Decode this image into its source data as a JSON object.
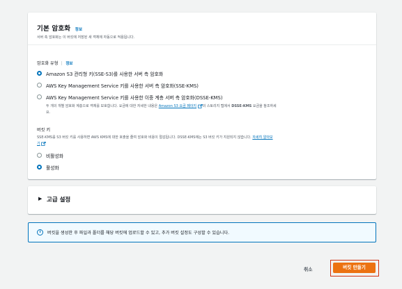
{
  "encryption": {
    "title": "기본 암호화",
    "info_label": "정보",
    "description": "서버 측 암호화는 이 버킷에 저장된 새 객체에 자동으로 적용됩니다.",
    "type_label": "암호화 유형",
    "type_info_label": "정보",
    "options": [
      {
        "label": "Amazon S3 관리형 키(SSE-S3)를 사용한 서버 측 암호화",
        "selected": true
      },
      {
        "label": "AWS Key Management Service 키를 사용한 서버 측 암호화(SSE-KMS)",
        "selected": false
      },
      {
        "label": "AWS Key Management Service 키를 사용한 이중 계층 서버 측 암호화(DSSE-KMS)",
        "selected": false
      }
    ],
    "dsse_desc_pre": "두 개의 개별 암호화 계층으로 객체를 보호합니다. 요금에 대한 자세한 내용은 ",
    "dsse_desc_link": "Amazon S3 요금 페이지",
    "dsse_desc_post": "의 스토리지 탭에서 ",
    "dsse_desc_bold": "DSSE-KMS",
    "dsse_desc_post2": " 요금을 참조하세",
    "dsse_desc_line2": "요."
  },
  "bucket_key": {
    "label": "버킷 키",
    "desc_line1": "SSE-KMS를 S3 버킷 키를 사용하면 AWS KMS에 대한 호출을 줄여 암호화 비용이 절감됩니다. DSSE-KMS에는 S3 버킷 키가 지원되지 않습니다. ",
    "desc_link_1": "자세히 알아보",
    "desc_link_2": "기",
    "options": [
      {
        "label": "비활성화",
        "selected": false
      },
      {
        "label": "활성화",
        "selected": true
      }
    ]
  },
  "advanced": {
    "title": "고급 설정"
  },
  "alert": {
    "text": "버킷을 생성한 후 파일과 폴더를 해당 버킷에 업로드할 수 있고, 추가 버킷 설정도 구성할 수 있습니다."
  },
  "footer": {
    "cancel_label": "취소",
    "create_label": "버킷 만들기"
  },
  "colors": {
    "link": "#0073bb",
    "primary_button": "#ec7211",
    "highlight_border": "#d13212"
  }
}
